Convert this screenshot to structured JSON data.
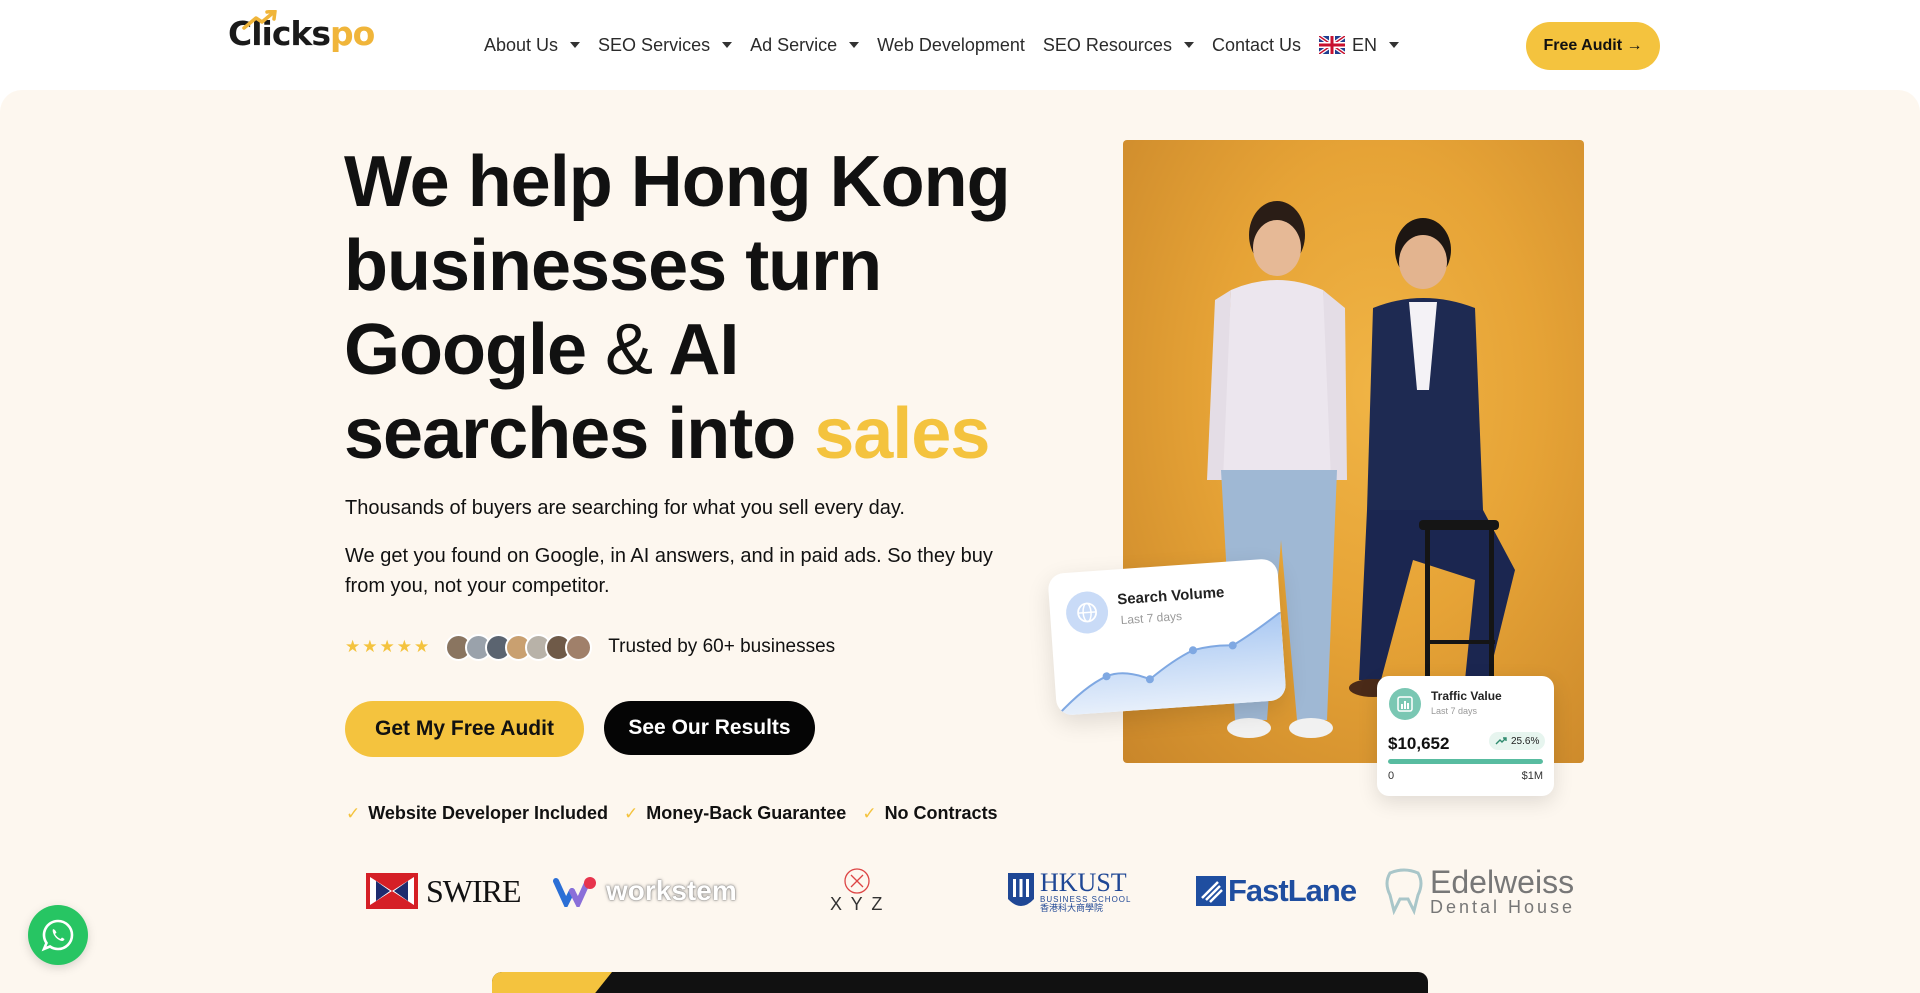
{
  "brand": {
    "logo_text_main": "Clicks",
    "logo_text_accent": "po",
    "accent_color": "#f4c33e",
    "hero_bg": "#fdf7ef"
  },
  "nav": {
    "items": [
      {
        "label": "About Us",
        "has_dropdown": true
      },
      {
        "label": "SEO Services",
        "has_dropdown": true
      },
      {
        "label": "Ad Service",
        "has_dropdown": true
      },
      {
        "label": "Web Development",
        "has_dropdown": false
      },
      {
        "label": "SEO Resources",
        "has_dropdown": true
      },
      {
        "label": "Contact Us",
        "has_dropdown": false
      }
    ],
    "language": "EN",
    "cta_label": "Free Audit →"
  },
  "hero": {
    "headline_1": "We help Hong Kong",
    "headline_2": "businesses turn",
    "headline_3a": "Google",
    "headline_3b": "&",
    "headline_3c": "AI",
    "headline_4a": "searches into",
    "headline_4b": "sales",
    "sub1": "Thousands of buyers are searching for what you sell every day.",
    "sub2": "We get you found on Google, in AI answers, and in paid ads. So they buy from you, not your competitor.",
    "rating_stars": 5,
    "trust_text": "Trusted by 60+ businesses",
    "primary_button": "Get My Free Audit",
    "secondary_button": "See Our Results",
    "checks": [
      "Website Developer Included",
      "Money-Back Guarantee",
      "No Contracts"
    ]
  },
  "search_card": {
    "title": "Search Volume",
    "subtitle": "Last 7 days"
  },
  "traffic_card": {
    "title": "Traffic Value",
    "subtitle": "Last 7 days",
    "value": "$10,652",
    "change": "25.6%",
    "progress_fraction": 1.0,
    "range_min": "0",
    "range_max": "$1M"
  },
  "clients": {
    "swire": "SWIRE",
    "workstem": "workstem",
    "xyz": "X Y Z",
    "hkust_main": "HKUST",
    "hkust_sub": "BUSINESS SCHOOL",
    "hkust_cn": "香港科大商學院",
    "fastlane": "FastLane",
    "edelweiss_main": "Edelweiss",
    "edelweiss_sub": "Dental House"
  }
}
